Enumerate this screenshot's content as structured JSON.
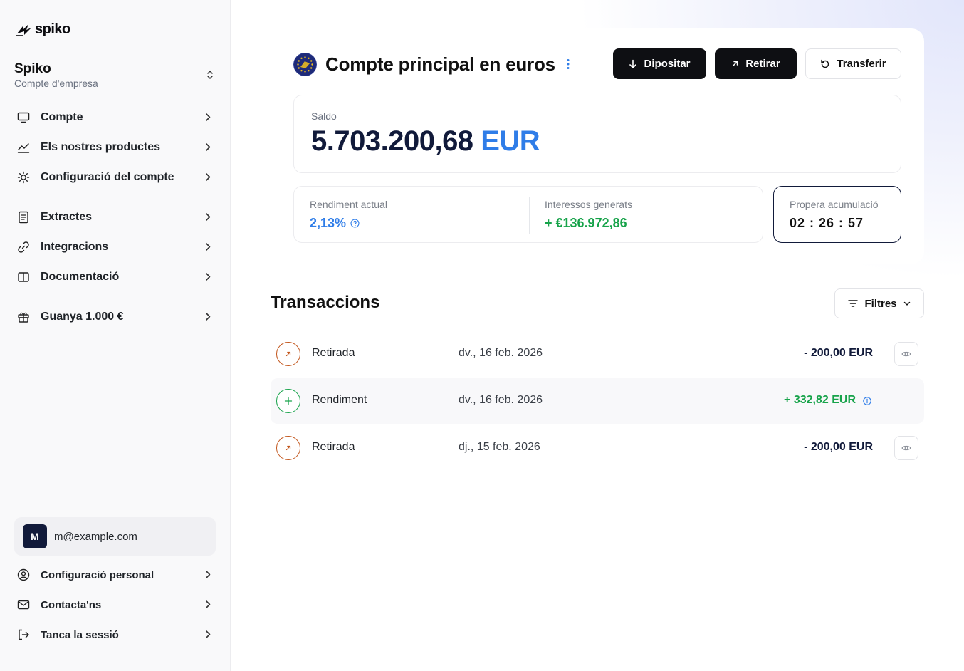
{
  "brand": {
    "logo_text": "spiko"
  },
  "organization": {
    "name": "Spiko",
    "subtitle": "Compte d'empresa"
  },
  "sidebar": {
    "nav": [
      {
        "label": "Compte",
        "icon": "monitor-icon"
      },
      {
        "label": "Els nostres productes",
        "icon": "chart-line-icon"
      },
      {
        "label": "Configuració del compte",
        "icon": "sun-gear-icon"
      },
      {
        "label": "Extractes",
        "icon": "document-icon"
      },
      {
        "label": "Integracions",
        "icon": "link-icon"
      },
      {
        "label": "Documentació",
        "icon": "book-icon"
      },
      {
        "label": "Guanya 1.000 €",
        "icon": "gift-icon"
      }
    ],
    "user": {
      "initial": "M",
      "email": "m@example.com"
    },
    "footer": [
      {
        "label": "Configuració personal",
        "icon": "user-circle-icon"
      },
      {
        "label": "Contacta'ns",
        "icon": "mail-icon"
      },
      {
        "label": "Tanca la sessió",
        "icon": "logout-icon"
      }
    ]
  },
  "account": {
    "title": "Compte principal en euros",
    "flag_icon": "eu-flag-icon",
    "actions": {
      "deposit": "Dipositar",
      "withdraw": "Retirar",
      "transfer": "Transferir"
    },
    "balance": {
      "label": "Saldo",
      "amount": "5.703.200,68",
      "currency": "EUR"
    },
    "stats": {
      "yield_label": "Rendiment actual",
      "yield_value": "2,13%",
      "interest_label": "Interessos generats",
      "interest_value": "+ €136.972,86",
      "accrual_label": "Propera acumulació",
      "accrual_value": "02 : 26 : 57"
    }
  },
  "transactions": {
    "title": "Transaccions",
    "filter_label": "Filtres",
    "rows": [
      {
        "type": "Retirada",
        "date": "dv., 16 feb. 2026",
        "amount": "- 200,00 EUR",
        "kind": "out"
      },
      {
        "type": "Rendiment",
        "date": "dv., 16 feb. 2026",
        "amount": "+ 332,82 EUR",
        "kind": "in"
      },
      {
        "type": "Retirada",
        "date": "dj., 15 feb. 2026",
        "amount": "- 200,00 EUR",
        "kind": "out"
      }
    ]
  },
  "colors": {
    "accent_blue": "#2f7de8",
    "positive_green": "#17a34a",
    "withdraw_orange": "#c2551b",
    "navy": "#111a3a",
    "button_dark": "#0e0f13"
  }
}
